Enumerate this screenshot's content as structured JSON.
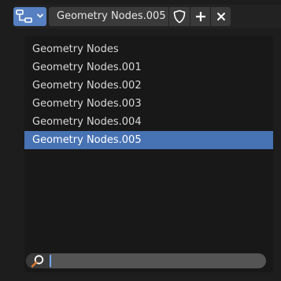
{
  "header": {
    "datablock_icon": "node-tree-icon",
    "current_name": "Geometry Nodes.005",
    "fake_user_icon": "shield-icon",
    "new_icon": "plus-icon",
    "unlink_icon": "close-icon"
  },
  "list": {
    "items": [
      {
        "label": "Geometry Nodes"
      },
      {
        "label": "Geometry Nodes.001"
      },
      {
        "label": "Geometry Nodes.002"
      },
      {
        "label": "Geometry Nodes.003"
      },
      {
        "label": "Geometry Nodes.004"
      },
      {
        "label": "Geometry Nodes.005"
      }
    ],
    "selected_index": 5
  },
  "search": {
    "value": "",
    "placeholder": ""
  },
  "colors": {
    "accent": "#4772b3",
    "button_blue": "#5680c2",
    "background": "#181818"
  }
}
